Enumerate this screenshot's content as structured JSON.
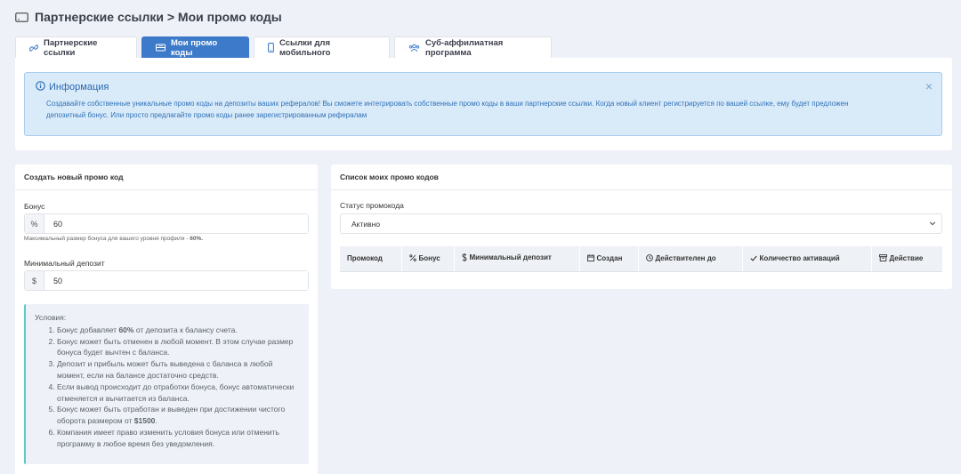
{
  "page": {
    "title": "Партнерские ссылки > Мои промо коды"
  },
  "tabs": [
    {
      "label": "Партнерские ссылки",
      "icon": "link-icon"
    },
    {
      "label": "Мои промо коды",
      "icon": "ticket-icon",
      "active": true
    },
    {
      "label": "Ссылки для мобильного",
      "icon": "mobile-icon"
    },
    {
      "label": "Суб-аффилиатная программа",
      "icon": "users-icon"
    }
  ],
  "info": {
    "title": "Информация",
    "text": "Создавайте собственные уникальные промо коды на депозиты ваших рефералов! Вы сможете интегрировать собственные промо коды в ваши партнерские ссылки. Когда новый клиент регистрируется по вашей ссылке, ему будет предложен депозитный бонус. Или просто предлагайте промо коды ранее зарегистрированным рефералам",
    "close": "×"
  },
  "create": {
    "header": "Создать новый промо код",
    "bonus_label": "Бонус",
    "bonus_addon": "%",
    "bonus_value": "60",
    "bonus_hint_prefix": "Максимальный размер бонуса для вашего уровня профиля - ",
    "bonus_hint_value": "60%.",
    "deposit_label": "Минимальный депозит",
    "deposit_addon": "$",
    "deposit_value": "50"
  },
  "conditions": {
    "title": "Условия:",
    "item1_a": "Бонус добавляет ",
    "item1_b": "60%",
    "item1_c": " от депозита к балансу счета.",
    "item2": "Бонус может быть отменен в любой момент. В этом случае размер бонуса будет вычтен с баланса.",
    "item3": "Депозит и прибыль может быть выведена с баланса в любой момент, если на балансе достаточно средств.",
    "item4": "Если вывод происходит до отработки бонуса, бонус автоматически отменяется и вычитается из баланса.",
    "item5_a": "Бонус может быть отработан и выведен при достижении чистого оборота размером от ",
    "item5_b": "$1500",
    "item5_c": ".",
    "item6": "Компания имеет право изменить условия бонуса или отменить программу в любое время без уведомления."
  },
  "list": {
    "header": "Список моих промо кодов",
    "status_label": "Статус промокода",
    "status_value": "Активно",
    "columns": [
      {
        "label": "Промокод",
        "icon": ""
      },
      {
        "label": "Бонус",
        "icon": "percent-icon"
      },
      {
        "label": "Минимальный депозит",
        "icon": "dollar-icon"
      },
      {
        "label": "Создан",
        "icon": "calendar-icon"
      },
      {
        "label": "Действителен до",
        "icon": "clock-icon"
      },
      {
        "label": "Количество активаций",
        "icon": "check-icon"
      },
      {
        "label": "Действие",
        "icon": "archive-icon"
      }
    ]
  },
  "colors": {
    "accent": "#3d7ac9",
    "alert_bg": "#d9eaf9",
    "alert_text": "#2f72b8",
    "conditions_border": "#5fc9c4",
    "page_bg": "#eef2f8"
  }
}
